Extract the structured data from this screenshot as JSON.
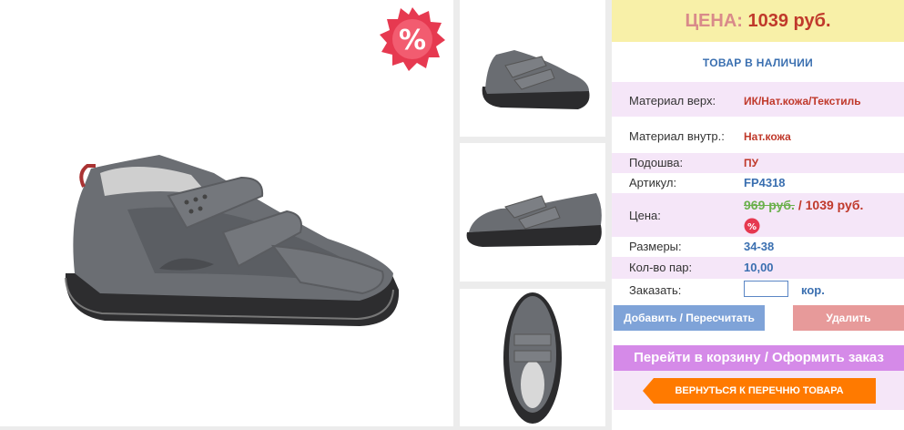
{
  "product": {
    "price_label": "ЦЕНА:",
    "price_value": "1039 руб.",
    "stock_status": "ТОВАР В НАЛИЧИИ",
    "discount_symbol": "%"
  },
  "specs": {
    "material_top": {
      "label": "Материал верх:",
      "value": "ИК/Нат.кожа/Текстиль"
    },
    "material_inner": {
      "label": "Материал внутр.:",
      "value": "Нат.кожа"
    },
    "sole": {
      "label": "Подошва:",
      "value": "ПУ"
    },
    "article": {
      "label": "Артикул:",
      "value": "FP4318"
    },
    "price": {
      "label": "Цена:",
      "old": "969 руб.",
      "separator": " / ",
      "new": "1039 руб."
    },
    "sizes": {
      "label": "Размеры:",
      "value": "34-38"
    },
    "pairs": {
      "label": "Кол-во пар:",
      "value": "10,00"
    },
    "order": {
      "label": "Заказать:",
      "unit": "кор.",
      "input_value": ""
    }
  },
  "actions": {
    "add": "Добавить / Пересчитать",
    "delete": "Удалить",
    "cart": "Перейти в корзину / Оформить заказ",
    "back": "ВЕРНУТЬСЯ К ПЕРЕЧНЮ ТОВАРА"
  },
  "colors": {
    "price_bg": "#f8f0a8",
    "price_text": "#c0392b",
    "link_blue": "#3a6fb0",
    "row_pink": "#f5e6f8",
    "add_button": "#7fa3d8",
    "delete_button": "#e79a9a",
    "cart_button": "#d58ae8",
    "back_button": "#ff7a00",
    "badge": "#e63950"
  },
  "images": [
    {
      "name": "main-shoe-photo",
      "view": "side"
    },
    {
      "name": "thumb-angle",
      "view": "three-quarter"
    },
    {
      "name": "thumb-side",
      "view": "side"
    },
    {
      "name": "thumb-top",
      "view": "top"
    }
  ]
}
